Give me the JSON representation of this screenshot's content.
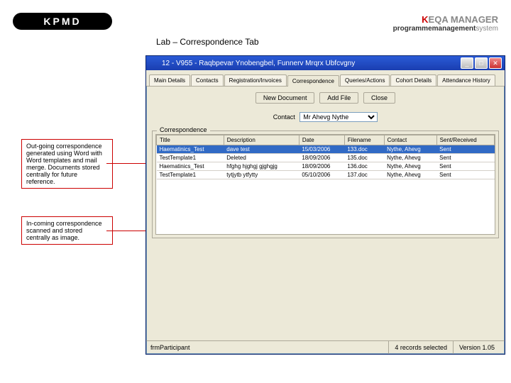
{
  "logo": "KPMD",
  "page_title": "Lab – Correspondence Tab",
  "brand": {
    "name": "EQA MANAGER",
    "tagline_pm": "programmemanagement",
    "tagline_sys": "system"
  },
  "window": {
    "title": "12 - V955 - Raqbpevar Ynobengbel, Funnerv Mrqrx Ubfcvgny",
    "min": "_",
    "max": "□",
    "close": "✕"
  },
  "tabs": [
    "Main Details",
    "Contacts",
    "Registration/Invoices",
    "Correspondence",
    "Queries/Actions",
    "Cohort Details",
    "Attendance History"
  ],
  "active_tab_index": 3,
  "toolbar": {
    "new_doc": "New Document",
    "add_file": "Add File",
    "close": "Close"
  },
  "contact": {
    "label": "Contact",
    "value": "Mr Ahevg Nythe"
  },
  "group_label": "Correspondence",
  "columns": [
    "Title",
    "Description",
    "Date",
    "Filename",
    "Contact",
    "Sent/Received"
  ],
  "rows": [
    {
      "title": "Haematinics_Test",
      "description": "dave test",
      "date": "15/03/2006",
      "filename": "133.doc",
      "contact": "Nythe, Ahevg",
      "sr": "Sent",
      "selected": true
    },
    {
      "title": "TestTemplate1",
      "description": "Deleted",
      "date": "18/09/2006",
      "filename": "135.doc",
      "contact": "Nythe, Ahevg",
      "sr": "Sent",
      "selected": false
    },
    {
      "title": "Haematinics_Test",
      "description": "hfghg hjghgj gjghgjg",
      "date": "18/09/2006",
      "filename": "136.doc",
      "contact": "Nythe, Ahevg",
      "sr": "Sent",
      "selected": false
    },
    {
      "title": "TestTemplate1",
      "description": "tytjytb ytfytty",
      "date": "05/10/2006",
      "filename": "137.doc",
      "contact": "Nythe, Ahevg",
      "sr": "Sent",
      "selected": false
    }
  ],
  "status": {
    "form": "frmParticipant",
    "records": "4 records selected",
    "version": "Version 1.05"
  },
  "callouts": {
    "outgoing": "Out-going correspondence generated using Word with Word templates and mail merge. Documents stored centrally for future reference.",
    "incoming": "In-coming correspondence scanned and stored centrally as image."
  }
}
